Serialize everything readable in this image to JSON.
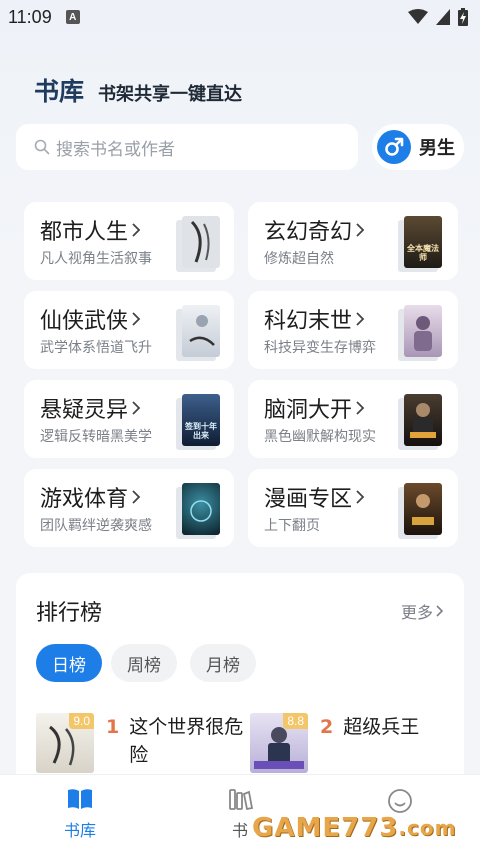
{
  "status": {
    "time": "11:09",
    "notif_letter": "A"
  },
  "header": {
    "title": "书库",
    "subtitle": "书架共享一键直达"
  },
  "search": {
    "placeholder": "搜索书名或作者",
    "icon": "search-icon"
  },
  "gender": {
    "label": "男生",
    "icon": "male-icon"
  },
  "categories": [
    {
      "name": "都市人生",
      "desc": "凡人视角生活叙事",
      "cover_text": "",
      "cover_color": "#d9dde4"
    },
    {
      "name": "玄幻奇幻",
      "desc": "修炼超自然",
      "cover_text": "全本魔法师",
      "cover_color": "#2c2a27"
    },
    {
      "name": "仙侠武侠",
      "desc": "武学体系悟道飞升",
      "cover_text": "",
      "cover_color": "#cfd6df"
    },
    {
      "name": "科幻末世",
      "desc": "科技异变生存博弈",
      "cover_text": "",
      "cover_color": "#c9b9cf"
    },
    {
      "name": "悬疑灵异",
      "desc": "逻辑反转暗黑美学",
      "cover_text": "签到十年出来",
      "cover_color": "#1c2d4a"
    },
    {
      "name": "脑洞大开",
      "desc": "黑色幽默解构现实",
      "cover_text": "",
      "cover_color": "#2a2420"
    },
    {
      "name": "游戏体育",
      "desc": "团队羁绊逆袭爽感",
      "cover_text": "",
      "cover_color": "#0f2f3a"
    },
    {
      "name": "漫画专区",
      "desc": "上下翻页",
      "cover_text": "",
      "cover_color": "#3a2a1c"
    }
  ],
  "ranking": {
    "title": "排行榜",
    "more": "更多",
    "tabs": [
      "日榜",
      "周榜",
      "月榜"
    ],
    "active_tab": "日榜",
    "items": [
      {
        "rank": "1",
        "title": "这个世界很危险",
        "score": "9.0",
        "cover_color": "#e9e6df"
      },
      {
        "rank": "2",
        "title": "超级兵王",
        "score": "8.8",
        "cover_color": "#d7d4ea"
      }
    ]
  },
  "nav": {
    "items": [
      {
        "label": "书库",
        "active": true
      },
      {
        "label": "书",
        "active": false
      },
      {
        "label": "",
        "active": false
      }
    ]
  },
  "colors": {
    "accent": "#1e7ee8",
    "rank_number": "#e2754a",
    "score_badge": "#f3c66a"
  },
  "watermark": {
    "text": "GAME773",
    "suffix": ".com"
  }
}
